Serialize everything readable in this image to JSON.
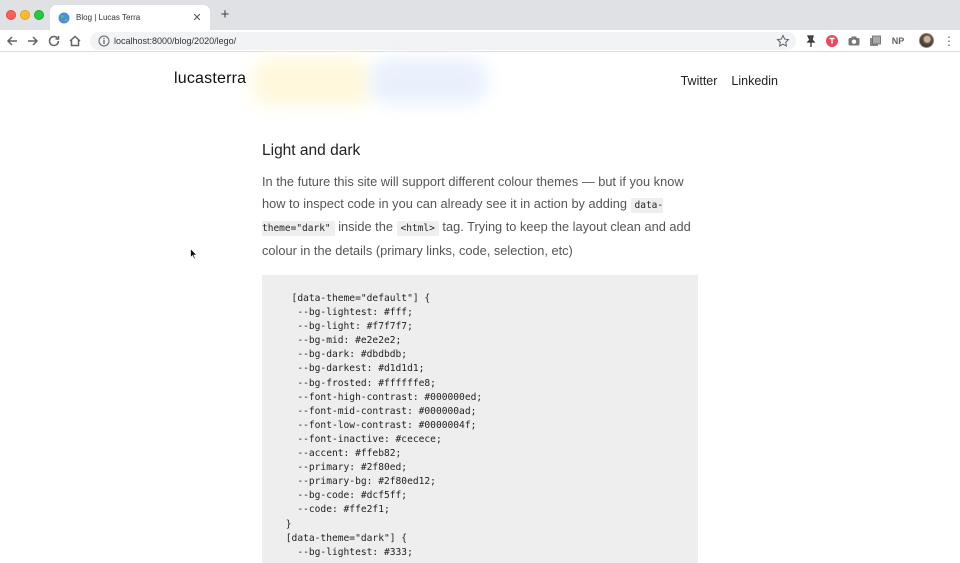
{
  "browser": {
    "tab_title": "Blog | Lucas Terra",
    "tab_close": "✕",
    "new_tab": "+",
    "url": "localhost:8000/blog/2020/lego/",
    "ext_np": "NP",
    "menu": "⋮",
    "icons": [
      "back-arrow-icon",
      "forward-arrow-icon",
      "reload-icon",
      "home-icon",
      "info-icon",
      "star-icon",
      "extension-icons",
      "avatar",
      "menu-dots-icon"
    ]
  },
  "site": {
    "logo": "lucasterra",
    "nav": [
      "Twitter",
      "Linkedin"
    ]
  },
  "article": {
    "heading": "Light and dark",
    "paragraph": {
      "text_1": "In the future this site will support different colour themes — but if you know how to inspect code in you can already see it in action by adding ",
      "code_1": "data-theme=\"dark\"",
      "text_2": " inside the ",
      "code_2": "<html>",
      "text_3": " tag. Trying to keep the layout clean and add colour in the details (primary links, code, selection, etc)"
    },
    "code_lines": [
      "  [data-theme=\"default\"] {",
      "   --bg-lightest: #fff;",
      "   --bg-light: #f7f7f7;",
      "   --bg-mid: #e2e2e2;",
      "   --bg-dark: #dbdbdb;",
      "   --bg-darkest: #d1d1d1;",
      "   --bg-frosted: #ffffffe8;",
      "   --font-high-contrast: #000000ed;",
      "   --font-mid-contrast: #000000ad;",
      "   --font-low-contrast: #0000004f;",
      "   --font-inactive: #cecece;",
      "   --accent: #ffeb82;",
      "   --primary: #2f80ed;",
      "   --primary-bg: #2f80ed12;",
      "   --bg-code: #dcf5ff;",
      "   --code: #ffe2f1;",
      " }",
      " [data-theme=\"dark\"] {",
      "   --bg-lightest: #333;"
    ]
  }
}
